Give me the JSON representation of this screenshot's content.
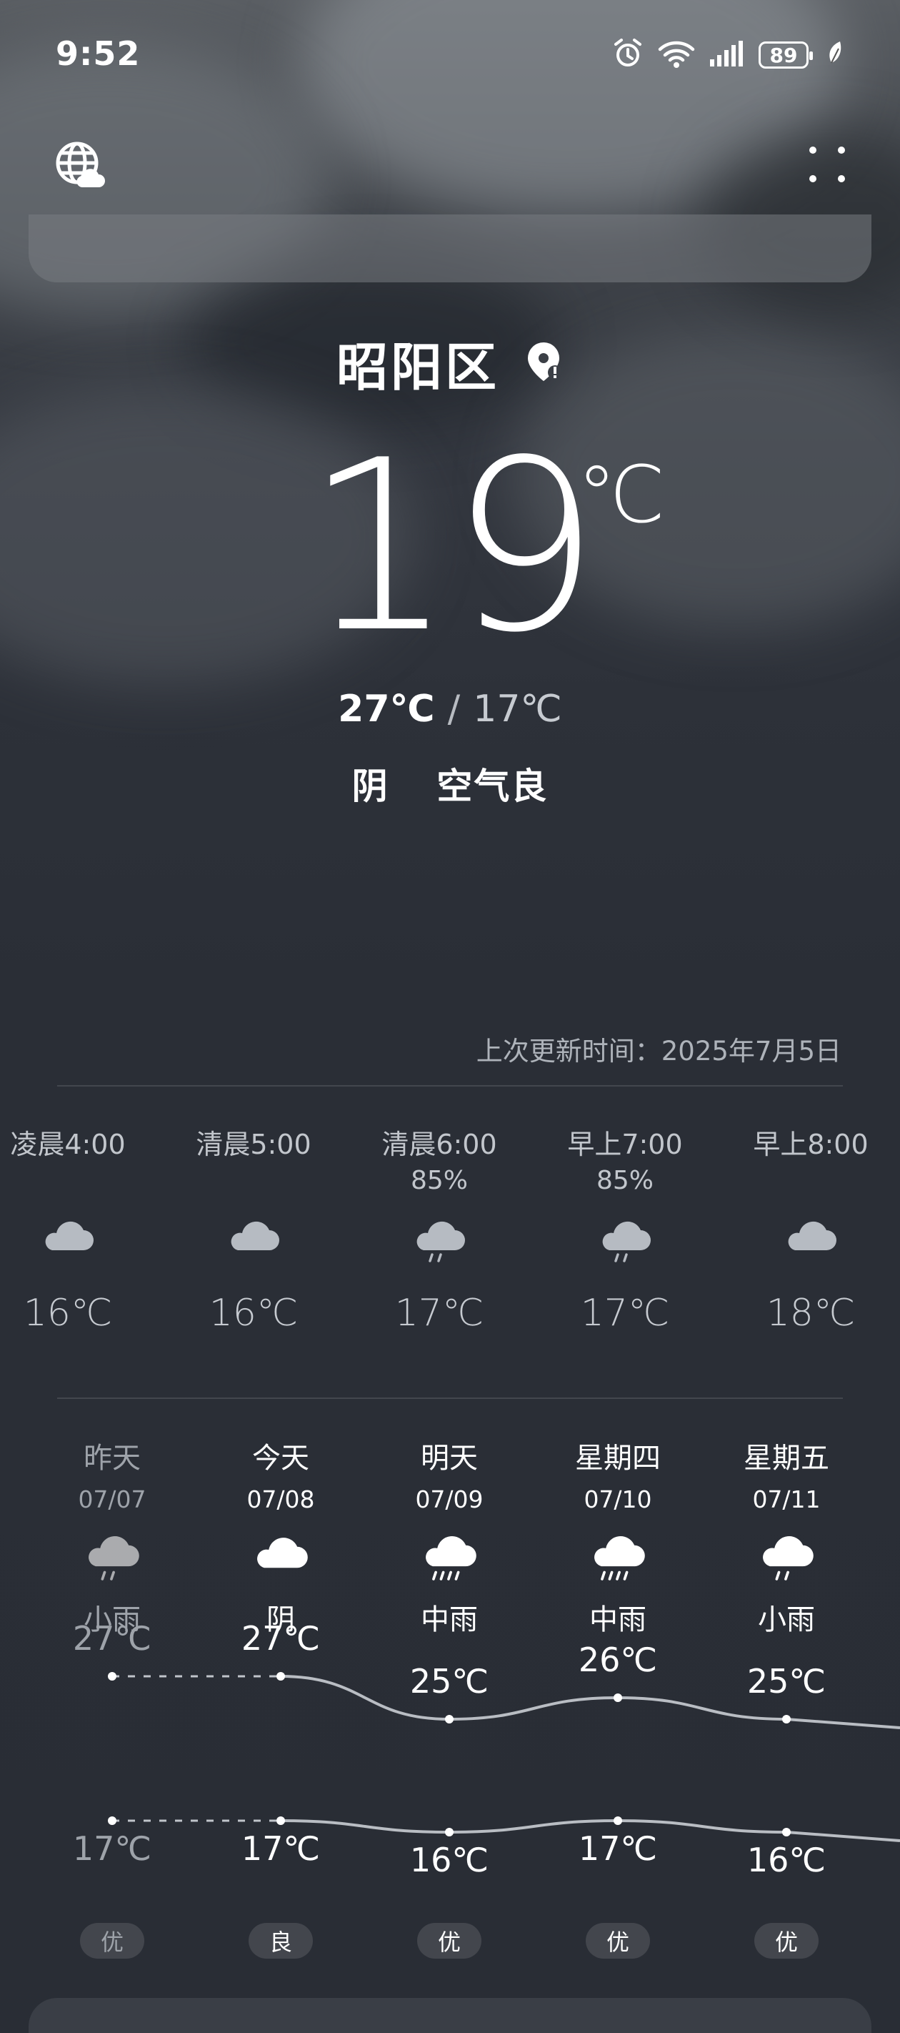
{
  "status_bar": {
    "time": "9:52",
    "battery": "89",
    "icons": [
      "alarm-icon",
      "wifi-icon",
      "signal-icon",
      "battery-icon",
      "leaf-icon"
    ]
  },
  "header": {
    "globe_icon": "globe-cloud-icon",
    "menu_icon": "grid-dots-icon"
  },
  "location": {
    "city": "昭阳区",
    "pin_icon": "location-pin-icon"
  },
  "current": {
    "temperature": "19",
    "unit": "℃",
    "high": "27℃",
    "separator": "/",
    "low": "17℃",
    "condition": "阴",
    "air_quality": "空气良"
  },
  "updated": "上次更新时间：2025年7月5日",
  "hourly": [
    {
      "time": "凌晨4:00",
      "prob": "",
      "icon": "cloud-icon",
      "temp": "16℃"
    },
    {
      "time": "清晨5:00",
      "prob": "",
      "icon": "cloud-icon",
      "temp": "16℃"
    },
    {
      "time": "清晨6:00",
      "prob": "85%",
      "icon": "rain-cloud-icon",
      "temp": "17℃"
    },
    {
      "time": "早上7:00",
      "prob": "85%",
      "icon": "rain-cloud-icon",
      "temp": "17℃"
    },
    {
      "time": "早上8:00",
      "prob": "",
      "icon": "cloud-icon",
      "temp": "18℃"
    }
  ],
  "daily": [
    {
      "name": "昨天",
      "date": "07/07",
      "icon": "light-rain-icon",
      "desc": "小雨",
      "high": "27℃",
      "low": "17℃",
      "aqi": "优"
    },
    {
      "name": "今天",
      "date": "07/08",
      "icon": "cloudy-icon",
      "desc": "阴",
      "high": "27℃",
      "low": "17℃",
      "aqi": "良"
    },
    {
      "name": "明天",
      "date": "07/09",
      "icon": "moderate-rain-icon",
      "desc": "中雨",
      "high": "25℃",
      "low": "16℃",
      "aqi": "优"
    },
    {
      "name": "星期四",
      "date": "07/10",
      "icon": "moderate-rain-icon",
      "desc": "中雨",
      "high": "26℃",
      "low": "17℃",
      "aqi": "优"
    },
    {
      "name": "星期五",
      "date": "07/11",
      "icon": "light-rain-icon",
      "desc": "小雨",
      "high": "25℃",
      "low": "16℃",
      "aqi": "优"
    }
  ]
}
